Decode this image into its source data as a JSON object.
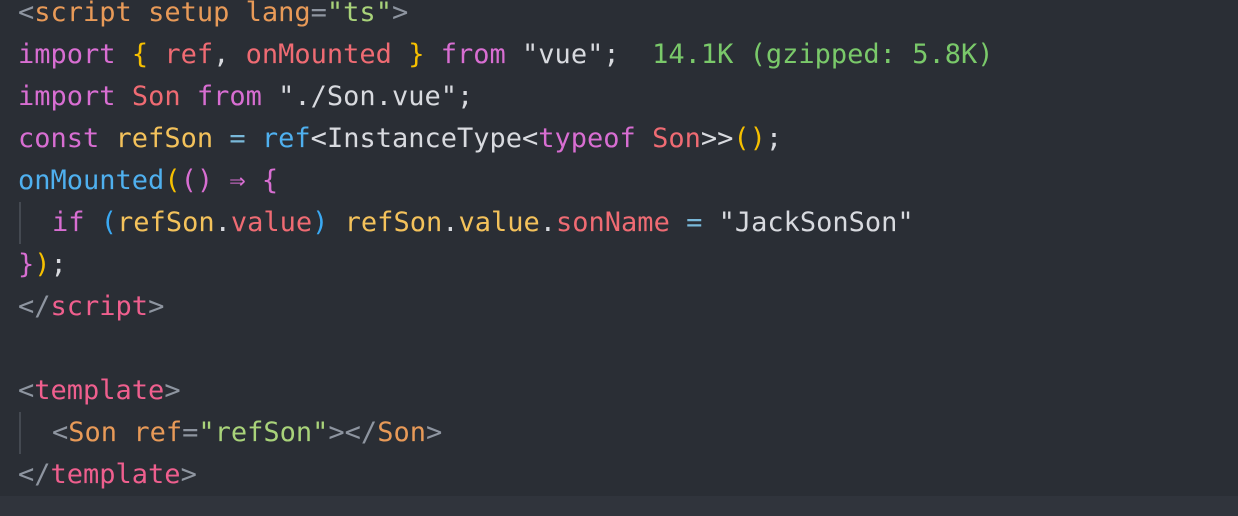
{
  "lines": [
    {
      "tokens": [
        {
          "t": "<",
          "c": "punct"
        },
        {
          "t": "script",
          "c": "attr"
        },
        {
          "t": " ",
          "c": "plain"
        },
        {
          "t": "setup",
          "c": "attr"
        },
        {
          "t": " ",
          "c": "plain"
        },
        {
          "t": "lang",
          "c": "attr"
        },
        {
          "t": "=",
          "c": "punct"
        },
        {
          "t": "\"ts\"",
          "c": "str"
        },
        {
          "t": ">",
          "c": "punct"
        }
      ]
    },
    {
      "tokens": [
        {
          "t": "import",
          "c": "key"
        },
        {
          "t": " ",
          "c": "plain"
        },
        {
          "t": "{",
          "c": "brace1"
        },
        {
          "t": " ",
          "c": "plain"
        },
        {
          "t": "ref",
          "c": "var"
        },
        {
          "t": ", ",
          "c": "plain"
        },
        {
          "t": "onMounted",
          "c": "var"
        },
        {
          "t": " ",
          "c": "plain"
        },
        {
          "t": "}",
          "c": "brace1"
        },
        {
          "t": " ",
          "c": "plain"
        },
        {
          "t": "from",
          "c": "key"
        },
        {
          "t": " ",
          "c": "plain"
        },
        {
          "t": "\"vue\"",
          "c": "plain"
        },
        {
          "t": ";",
          "c": "plain"
        },
        {
          "t": "  ",
          "c": "plain"
        },
        {
          "t": "14.1K (gzipped: 5.8K)",
          "c": "hint"
        }
      ]
    },
    {
      "tokens": [
        {
          "t": "import",
          "c": "key"
        },
        {
          "t": " ",
          "c": "plain"
        },
        {
          "t": "Son",
          "c": "var"
        },
        {
          "t": " ",
          "c": "plain"
        },
        {
          "t": "from",
          "c": "key"
        },
        {
          "t": " ",
          "c": "plain"
        },
        {
          "t": "\"./Son.vue\"",
          "c": "plain"
        },
        {
          "t": ";",
          "c": "plain"
        }
      ]
    },
    {
      "tokens": [
        {
          "t": "const",
          "c": "key"
        },
        {
          "t": " ",
          "c": "plain"
        },
        {
          "t": "refSon",
          "c": "def"
        },
        {
          "t": " ",
          "c": "plain"
        },
        {
          "t": "=",
          "c": "op"
        },
        {
          "t": " ",
          "c": "plain"
        },
        {
          "t": "ref",
          "c": "fn"
        },
        {
          "t": "<",
          "c": "plain"
        },
        {
          "t": "InstanceType",
          "c": "plain"
        },
        {
          "t": "<",
          "c": "plain"
        },
        {
          "t": "typeof",
          "c": "key"
        },
        {
          "t": " ",
          "c": "plain"
        },
        {
          "t": "Son",
          "c": "type"
        },
        {
          "t": ">>",
          "c": "plain"
        },
        {
          "t": "()",
          "c": "brace1"
        },
        {
          "t": ";",
          "c": "plain"
        }
      ]
    },
    {
      "tokens": [
        {
          "t": "onMounted",
          "c": "fn"
        },
        {
          "t": "(",
          "c": "brace1"
        },
        {
          "t": "()",
          "c": "brace2"
        },
        {
          "t": " ",
          "c": "plain"
        },
        {
          "t": "⇒",
          "c": "key"
        },
        {
          "t": " ",
          "c": "plain"
        },
        {
          "t": "{",
          "c": "brace2"
        }
      ]
    },
    {
      "indent": true,
      "tokens": [
        {
          "t": "if",
          "c": "key"
        },
        {
          "t": " ",
          "c": "plain"
        },
        {
          "t": "(",
          "c": "brace3"
        },
        {
          "t": "refSon",
          "c": "def"
        },
        {
          "t": ".",
          "c": "plain"
        },
        {
          "t": "value",
          "c": "prop"
        },
        {
          "t": ")",
          "c": "brace3"
        },
        {
          "t": " ",
          "c": "plain"
        },
        {
          "t": "refSon",
          "c": "def"
        },
        {
          "t": ".",
          "c": "plain"
        },
        {
          "t": "value",
          "c": "def"
        },
        {
          "t": ".",
          "c": "plain"
        },
        {
          "t": "sonName",
          "c": "prop"
        },
        {
          "t": " ",
          "c": "plain"
        },
        {
          "t": "=",
          "c": "op"
        },
        {
          "t": " ",
          "c": "plain"
        },
        {
          "t": "\"JackSonSon\"",
          "c": "plain"
        }
      ]
    },
    {
      "tokens": [
        {
          "t": "}",
          "c": "brace2"
        },
        {
          "t": ")",
          "c": "brace1"
        },
        {
          "t": ";",
          "c": "plain"
        }
      ]
    },
    {
      "tokens": [
        {
          "t": "</",
          "c": "punct"
        },
        {
          "t": "script",
          "c": "tag"
        },
        {
          "t": ">",
          "c": "punct"
        }
      ]
    },
    {
      "tokens": []
    },
    {
      "tokens": [
        {
          "t": "<",
          "c": "punct"
        },
        {
          "t": "template",
          "c": "tag"
        },
        {
          "t": ">",
          "c": "punct"
        }
      ]
    },
    {
      "indent": true,
      "tokens": [
        {
          "t": "<",
          "c": "punct"
        },
        {
          "t": "Son",
          "c": "attr"
        },
        {
          "t": " ",
          "c": "plain"
        },
        {
          "t": "ref",
          "c": "attr"
        },
        {
          "t": "=",
          "c": "punct"
        },
        {
          "t": "\"refSon\"",
          "c": "str"
        },
        {
          "t": "></",
          "c": "punct"
        },
        {
          "t": "Son",
          "c": "attr"
        },
        {
          "t": ">",
          "c": "punct"
        }
      ]
    },
    {
      "tokens": [
        {
          "t": "</",
          "c": "punct"
        },
        {
          "t": "template",
          "c": "tag"
        },
        {
          "t": ">",
          "c": "punct"
        }
      ]
    }
  ]
}
